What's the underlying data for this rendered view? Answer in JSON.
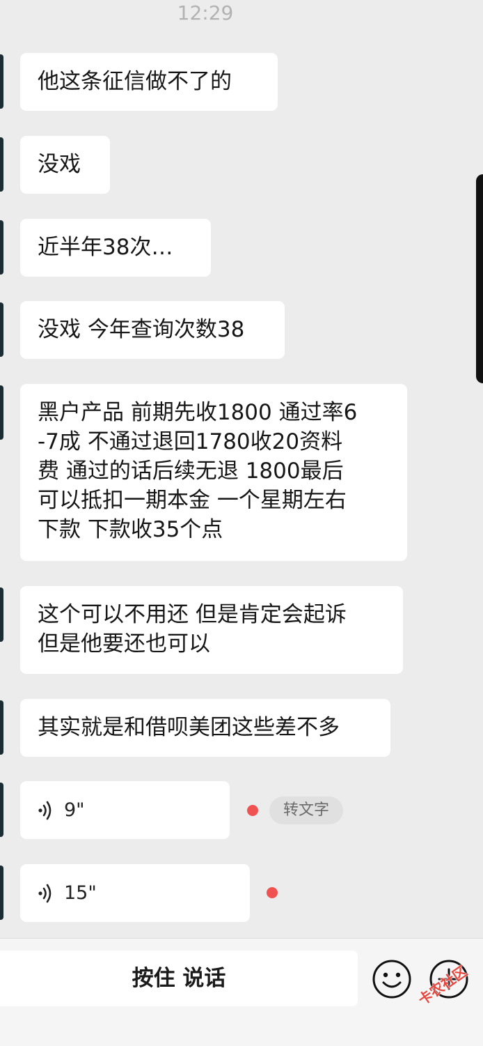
{
  "status": {
    "time": "12:29"
  },
  "messages": [
    {
      "text": "他这条征信做不了的"
    },
    {
      "text": "没戏"
    },
    {
      "text": "近半年38次…"
    },
    {
      "text": "没戏 今年查询次数38"
    },
    {
      "lines": [
        "黑户产品 前期先收1800 通过率6",
        "-7成 不通过退回1780收20资料",
        "费 通过的话后续无退 1800最后",
        "可以抵扣一期本金 一个星期左右",
        "下款 下款收35个点"
      ]
    },
    {
      "lines": [
        "这个可以不用还 但是肯定会起诉",
        "但是他要还也可以"
      ]
    },
    {
      "text": "其实就是和借呗美团这些差不多"
    }
  ],
  "voice_messages": [
    {
      "duration": "9\"",
      "to_text_label": "转文字"
    },
    {
      "duration": "15\""
    }
  ],
  "input_bar": {
    "hold_to_talk_label": "按住 说话",
    "emoji_icon": "smiley-icon",
    "plus_icon": "plus-icon"
  },
  "watermark": {
    "text": "卡农社区"
  },
  "colors": {
    "background": "#ececec",
    "bubble": "#ffffff",
    "unread_dot": "#f05252"
  }
}
